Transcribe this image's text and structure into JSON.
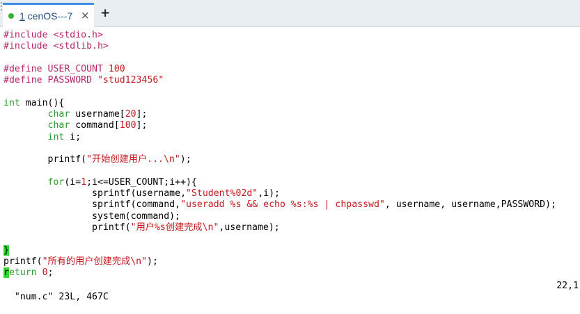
{
  "tab": {
    "number": "1",
    "title": " cenOS---7",
    "close_glyph": "×",
    "add_glyph": "+",
    "status_color": "#2fb62f"
  },
  "code_lines": [
    [
      {
        "t": "#include <stdio.h>",
        "c": "pp"
      }
    ],
    [
      {
        "t": "#include <stdlib.h>",
        "c": "pp"
      }
    ],
    [],
    [
      {
        "t": "#define USER_COUNT ",
        "c": "pp"
      },
      {
        "t": "100",
        "c": "num"
      }
    ],
    [
      {
        "t": "#define PASSWORD ",
        "c": "pp"
      },
      {
        "t": "\"stud123456\"",
        "c": "str"
      }
    ],
    [],
    [
      {
        "t": "int",
        "c": "kw"
      },
      {
        "t": " main(){"
      }
    ],
    [
      {
        "t": "        "
      },
      {
        "t": "char",
        "c": "kw"
      },
      {
        "t": " username["
      },
      {
        "t": "20",
        "c": "num"
      },
      {
        "t": "];"
      }
    ],
    [
      {
        "t": "        "
      },
      {
        "t": "char",
        "c": "kw"
      },
      {
        "t": " command["
      },
      {
        "t": "100",
        "c": "num"
      },
      {
        "t": "];"
      }
    ],
    [
      {
        "t": "        "
      },
      {
        "t": "int",
        "c": "kw"
      },
      {
        "t": " i;"
      }
    ],
    [],
    [
      {
        "t": "        printf("
      },
      {
        "t": "\"开始创建用户...\\n\"",
        "c": "str"
      },
      {
        "t": ");"
      }
    ],
    [],
    [
      {
        "t": "        "
      },
      {
        "t": "for",
        "c": "kw"
      },
      {
        "t": "(i="
      },
      {
        "t": "1",
        "c": "num"
      },
      {
        "t": ";i<=USER_COUNT;i++){"
      }
    ],
    [
      {
        "t": "                sprintf(username,"
      },
      {
        "t": "\"Student%02d\"",
        "c": "str"
      },
      {
        "t": ",i);"
      }
    ],
    [
      {
        "t": "                sprintf(command,"
      },
      {
        "t": "\"useradd %s && echo %s:%s | chpasswd\"",
        "c": "str"
      },
      {
        "t": ", username, username,PASSWORD);"
      }
    ],
    [
      {
        "t": "                system(command);"
      }
    ],
    [
      {
        "t": "                printf("
      },
      {
        "t": "\"用户%s创建完成\\n\"",
        "c": "str"
      },
      {
        "t": ",username);"
      }
    ],
    [],
    [
      {
        "t": "}",
        "c": "cur"
      }
    ],
    [
      {
        "t": "printf("
      },
      {
        "t": "\"所有的用户创建完成\\n\"",
        "c": "str"
      },
      {
        "t": ");"
      }
    ],
    [
      {
        "t": "r",
        "c": "cur"
      },
      {
        "t": "eturn",
        "c": "kw"
      },
      {
        "t": " "
      },
      {
        "t": "0",
        "c": "num"
      },
      {
        "t": ";"
      }
    ]
  ],
  "status": {
    "file_info": "\"num.c\" 23L, 467C",
    "cursor_pos": "22,1"
  }
}
